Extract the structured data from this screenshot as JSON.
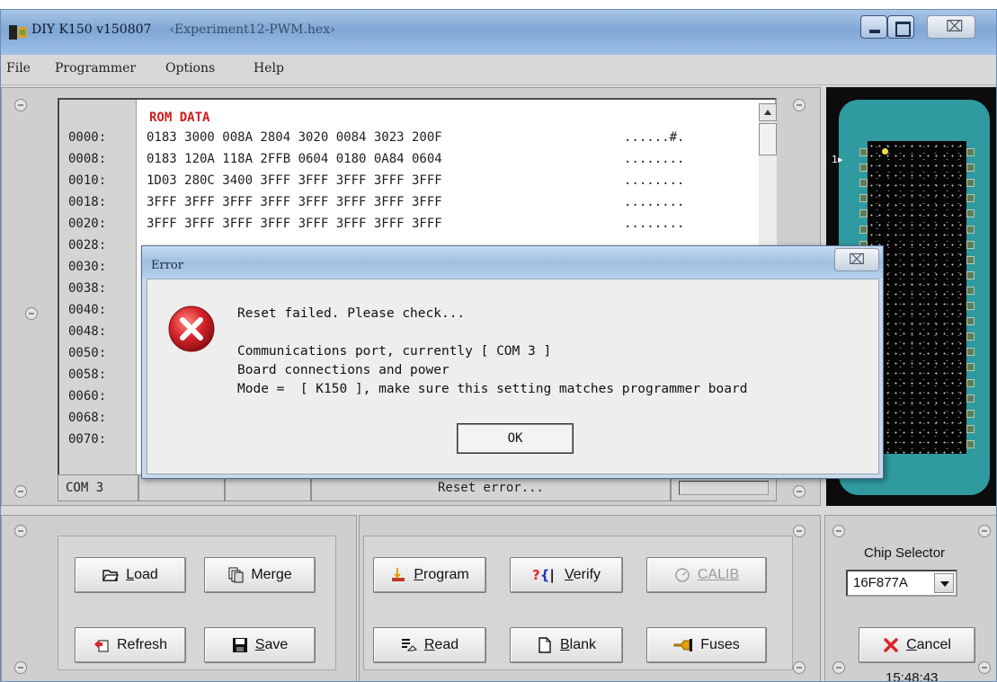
{
  "window": {
    "app_title": "DIY K150 v150807",
    "doc_title": "‹Experiment12-PWM.hex›",
    "close_glyph": "⌧"
  },
  "menu": [
    "File",
    "Programmer",
    "Options",
    "Help"
  ],
  "rom": {
    "title": "ROM DATA",
    "rows": [
      {
        "addr": "0000:",
        "hex": "0183 3000 008A 2804 3020 0084 3023 200F",
        "ascii": "......#."
      },
      {
        "addr": "0008:",
        "hex": "0183 120A 118A 2FFB 0604 0180 0A84 0604",
        "ascii": "........"
      },
      {
        "addr": "0010:",
        "hex": "1D03 280C 3400 3FFF 3FFF 3FFF 3FFF 3FFF",
        "ascii": "........"
      },
      {
        "addr": "0018:",
        "hex": "3FFF 3FFF 3FFF 3FFF 3FFF 3FFF 3FFF 3FFF",
        "ascii": "........"
      },
      {
        "addr": "0020:",
        "hex": "3FFF 3FFF 3FFF 3FFF 3FFF 3FFF 3FFF 3FFF",
        "ascii": "........"
      },
      {
        "addr": "0028:",
        "hex": "",
        "ascii": ""
      },
      {
        "addr": "0030:",
        "hex": "",
        "ascii": ""
      },
      {
        "addr": "0038:",
        "hex": "",
        "ascii": ""
      },
      {
        "addr": "0040:",
        "hex": "",
        "ascii": ""
      },
      {
        "addr": "0048:",
        "hex": "",
        "ascii": ""
      },
      {
        "addr": "0050:",
        "hex": "",
        "ascii": ""
      },
      {
        "addr": "0058:",
        "hex": "",
        "ascii": ""
      },
      {
        "addr": "0060:",
        "hex": "",
        "ascii": ""
      },
      {
        "addr": "0068:",
        "hex": "",
        "ascii": ""
      },
      {
        "addr": "0070:",
        "hex": "",
        "ascii": ""
      }
    ]
  },
  "status": {
    "port": "COM 3",
    "message": "Reset error..."
  },
  "chip": {
    "pin1_label": "1",
    "selector_label": "Chip Selector",
    "selected": "16F877A"
  },
  "buttons": {
    "load": {
      "hot": "L",
      "rest": "oad"
    },
    "merge": "Merge",
    "refresh": "Refresh",
    "save": {
      "hot": "S",
      "rest": "ave"
    },
    "program": {
      "hot": "P",
      "rest": "rogram"
    },
    "verify": {
      "hot": "V",
      "rest": "erify"
    },
    "calib": "CALIB",
    "read": {
      "hot": "R",
      "rest": "ead"
    },
    "blank": {
      "hot": "B",
      "rest": "lank"
    },
    "fuses": "Fuses",
    "cancel": {
      "hot": "C",
      "rest": "ancel"
    }
  },
  "clock": "15:48:43",
  "dialog": {
    "title": "Error",
    "close_glyph": "⌧",
    "line1": "Reset failed. Please check...",
    "line2": "Communications port, currently [ COM 3 ]",
    "line3": "Board connections and power",
    "line4": "Mode =  [ K150 ], make sure this setting matches programmer board",
    "ok": "OK"
  },
  "colors": {
    "rom_title": "#d11c1c",
    "chip_teal": "#2f9aa0",
    "error_red": "#d8252a"
  }
}
